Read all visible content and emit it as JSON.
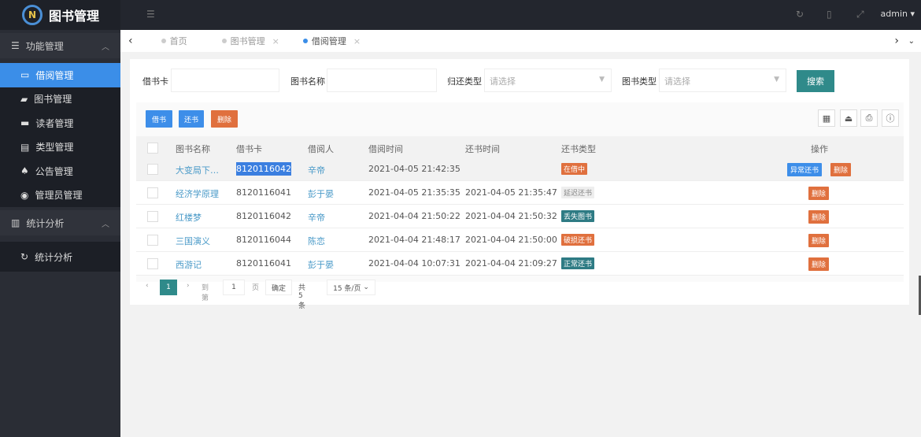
{
  "app": {
    "logo_text": "图书管理",
    "logo_mark": "N",
    "user": "admin"
  },
  "sidebar": {
    "groups": [
      {
        "label": "功能管理",
        "items": [
          {
            "label": "借阅管理",
            "active": true
          },
          {
            "label": "图书管理"
          },
          {
            "label": "读者管理"
          },
          {
            "label": "类型管理"
          },
          {
            "label": "公告管理"
          },
          {
            "label": "管理员管理"
          }
        ]
      },
      {
        "label": "统计分析",
        "items": [
          {
            "label": "统计分析"
          }
        ]
      }
    ]
  },
  "tabs": [
    {
      "label": "首页"
    },
    {
      "label": "图书管理"
    },
    {
      "label": "借阅管理",
      "active": true
    }
  ],
  "search": {
    "card_label": "借书卡",
    "card_value": "",
    "name_label": "图书名称",
    "name_value": "",
    "return_type_label": "归还类型",
    "return_type_placeholder": "请选择",
    "book_type_label": "图书类型",
    "book_type_placeholder": "请选择",
    "button": "搜索"
  },
  "toolbar": {
    "borrow": "借书",
    "return": "还书",
    "delete": "删除"
  },
  "table": {
    "headers": [
      "图书名称",
      "借书卡",
      "借阅人",
      "借阅时间",
      "还书时间",
      "还书类型",
      "操作"
    ],
    "rows": [
      {
        "book": "大变局下…",
        "card": "8120116042",
        "reader": "辛帝",
        "borrow_time": "2021-04-05 21:42:35",
        "return_time": "",
        "type": "在借中",
        "type_color": "#e0703e",
        "actions": [
          "异常还书",
          "删除"
        ]
      },
      {
        "book": "经济学原理",
        "card": "8120116041",
        "reader": "彭于晏",
        "borrow_time": "2021-04-05 21:35:35",
        "return_time": "2021-04-05 21:35:47",
        "type": "延迟还书",
        "type_color": "#eeeeee",
        "actions": [
          "删除"
        ]
      },
      {
        "book": "红楼梦",
        "card": "8120116042",
        "reader": "辛帝",
        "borrow_time": "2021-04-04 21:50:22",
        "return_time": "2021-04-04 21:50:32",
        "type": "丢失图书",
        "type_color": "#2e7b84",
        "actions": [
          "删除"
        ]
      },
      {
        "book": "三国演义",
        "card": "8120116044",
        "reader": "陈恋",
        "borrow_time": "2021-04-04 21:48:17",
        "return_time": "2021-04-04 21:50:00",
        "type": "破损还书",
        "type_color": "#e0703e",
        "actions": [
          "删除"
        ]
      },
      {
        "book": "西游记",
        "card": "8120116041",
        "reader": "彭于晏",
        "borrow_time": "2021-04-04 10:07:31",
        "return_time": "2021-04-04 21:09:27",
        "type": "正常还书",
        "type_color": "#2e7b84",
        "actions": [
          "删除"
        ]
      }
    ]
  },
  "pagination": {
    "current": "1",
    "goto_label": "到第",
    "goto_value": "1",
    "page_unit": "页",
    "confirm": "确定",
    "total": "共 5 条",
    "page_size": "15 条/页"
  }
}
